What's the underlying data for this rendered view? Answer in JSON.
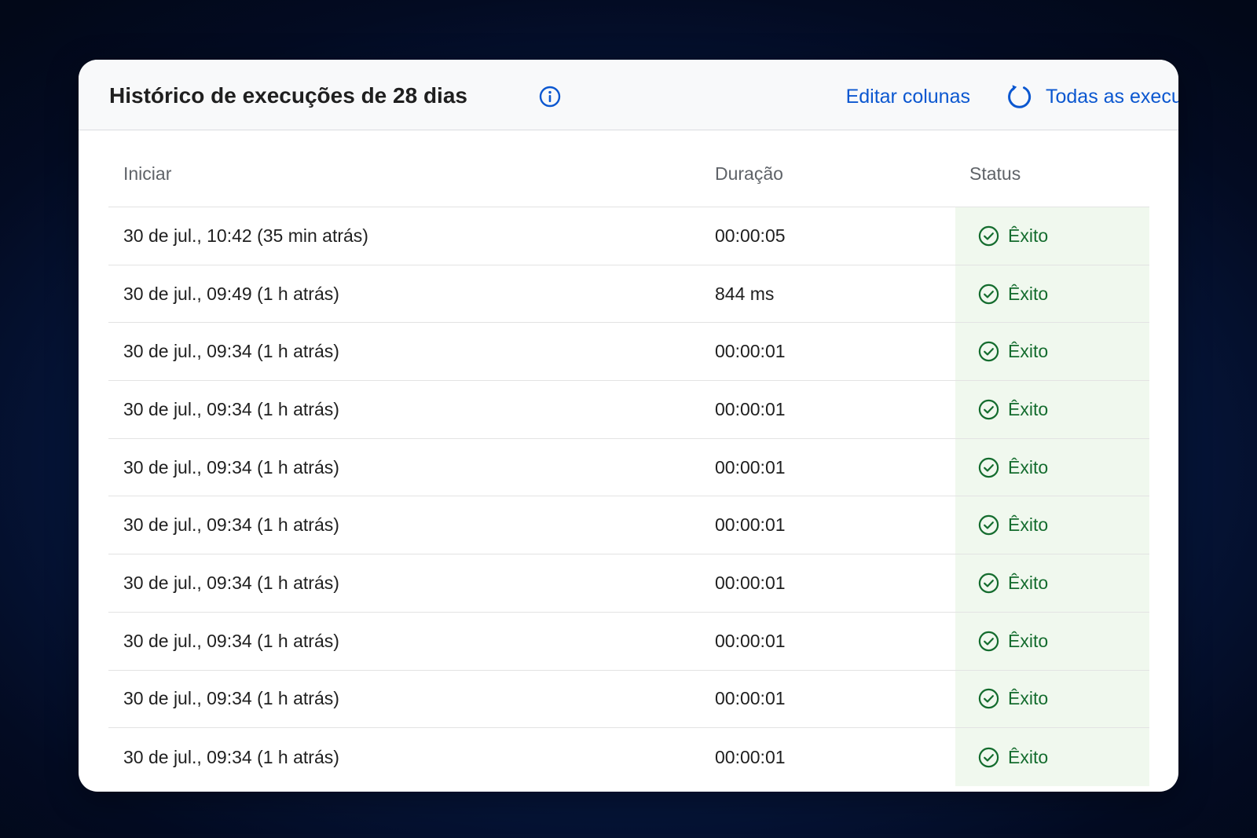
{
  "header": {
    "title": "Histórico de execuções de 28 dias",
    "info_icon": "info-icon",
    "edit_columns_label": "Editar colunas",
    "refresh_icon": "refresh-icon",
    "all_runs_label": "Todas as execuções"
  },
  "table": {
    "columns": {
      "start": "Iniciar",
      "duration": "Duração",
      "status": "Status"
    },
    "rows": [
      {
        "start": "30 de jul., 10:42 (35 min atrás)",
        "duration": "00:00:05",
        "status": "Êxito"
      },
      {
        "start": "30 de jul., 09:49 (1 h atrás)",
        "duration": "844 ms",
        "status": "Êxito"
      },
      {
        "start": "30 de jul., 09:34 (1 h atrás)",
        "duration": "00:00:01",
        "status": "Êxito"
      },
      {
        "start": "30 de jul., 09:34 (1 h atrás)",
        "duration": "00:00:01",
        "status": "Êxito"
      },
      {
        "start": "30 de jul., 09:34 (1 h atrás)",
        "duration": "00:00:01",
        "status": "Êxito"
      },
      {
        "start": "30 de jul., 09:34 (1 h atrás)",
        "duration": "00:00:01",
        "status": "Êxito"
      },
      {
        "start": "30 de jul., 09:34 (1 h atrás)",
        "duration": "00:00:01",
        "status": "Êxito"
      },
      {
        "start": "30 de jul., 09:34 (1 h atrás)",
        "duration": "00:00:01",
        "status": "Êxito"
      },
      {
        "start": "30 de jul., 09:34 (1 h atrás)",
        "duration": "00:00:01",
        "status": "Êxito"
      },
      {
        "start": "30 de jul., 09:34 (1 h atrás)",
        "duration": "00:00:01",
        "status": "Êxito"
      }
    ],
    "status_icon": "check-circle-icon"
  },
  "colors": {
    "accent": "#0b57d0",
    "success_text": "#146c2e",
    "success_bg": "#f0f8ee"
  }
}
